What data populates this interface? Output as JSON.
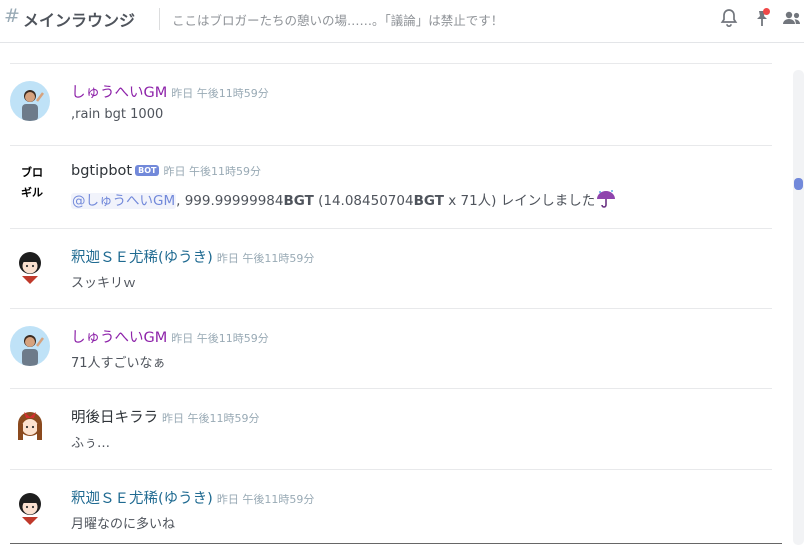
{
  "header": {
    "hash": "#",
    "channel_name": "メインラウンジ",
    "topic": "ここはブロガーたちの憩いの場……。「議論」は禁止です！",
    "icons": [
      "bell-icon",
      "pin-icon",
      "members-icon"
    ]
  },
  "messages": [
    {
      "username": "しゅうへいGM",
      "name_color": "#8e24aa",
      "timestamp": "昨日 午後11時59分",
      "text": ",rain bgt 1000"
    },
    {
      "username": "bgtipbot",
      "name_color": "#2e3338",
      "bot_tag": "BOT",
      "avatar_label": "ブロ\nギル",
      "timestamp": "昨日 午後11時59分",
      "mention": "@しゅうへいGM",
      "text_pre": ", 999.99999984",
      "text_b1": "BGT",
      "text_mid": " (14.08450704",
      "text_b2": "BGT",
      "text_post": " x 71人) レインしました",
      "emoji": "umbrella-icon"
    },
    {
      "username": "釈迦ＳＥ尤稀(ゆうき)",
      "name_color": "#1f6a91",
      "timestamp": "昨日 午後11時59分",
      "text": "スッキリｗ"
    },
    {
      "username": "しゅうへいGM",
      "name_color": "#8e24aa",
      "timestamp": "昨日 午後11時59分",
      "text": "71人すごいなぁ"
    },
    {
      "username": "明後日キララ",
      "name_color": "#2e3338",
      "timestamp": "昨日 午後11時59分",
      "text": "ふぅ…"
    },
    {
      "username": "釈迦ＳＥ尤稀(ゆうき)",
      "name_color": "#1f6a91",
      "timestamp": "昨日 午後11時59分",
      "text": "月曜なのに多いね"
    }
  ]
}
